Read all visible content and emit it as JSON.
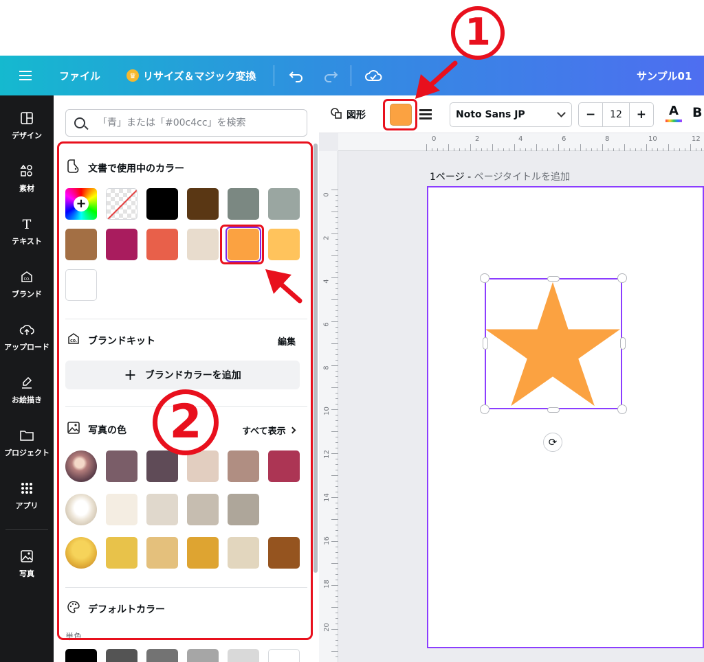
{
  "topbar": {
    "file_label": "ファイル",
    "resize_label": "リサイズ＆マジック変換",
    "doc_title": "サンプル01"
  },
  "rail": {
    "items": [
      {
        "label": "デザイン",
        "icon": "layout-icon"
      },
      {
        "label": "素材",
        "icon": "elements-icon"
      },
      {
        "label": "テキスト",
        "icon": "text-icon"
      },
      {
        "label": "ブランド",
        "icon": "brand-icon"
      },
      {
        "label": "アップロード",
        "icon": "upload-icon"
      },
      {
        "label": "お絵描き",
        "icon": "draw-icon"
      },
      {
        "label": "プロジェクト",
        "icon": "folder-icon"
      },
      {
        "label": "アプリ",
        "icon": "apps-icon"
      },
      {
        "label": "写真",
        "icon": "photo-icon"
      }
    ]
  },
  "panel": {
    "search_placeholder": "「青」または「#00c4cc」を検索",
    "doc_colors": {
      "title": "文書で使用中のカラー",
      "colors": [
        "#000000",
        "#5a3714",
        "#7b8882",
        "#9aa6a1",
        "#a36f44",
        "#a91c5e",
        "#e8604a",
        "#e8dccd",
        "#fba241",
        "#ffc35c",
        "#ffffff"
      ],
      "selected": "#fba241"
    },
    "brand_kit": {
      "title": "ブランドキット",
      "edit_label": "編集",
      "add_label": "ブランドカラーを追加"
    },
    "photo_colors": {
      "title": "写真の色",
      "show_all_label": "すべて表示",
      "rows": [
        [
          "#7a5d68",
          "#5f4b57",
          "#e2cec0",
          "#b08e82",
          "#ac3554"
        ],
        [
          "#f4ede2",
          "#e0d8cc",
          "#c6bdb0",
          "#aea69a"
        ],
        [
          "#e8c24a",
          "#e4c07c",
          "#dea431",
          "#e2d6be",
          "#95541f"
        ]
      ]
    },
    "default_colors": {
      "title": "デフォルトカラー",
      "subtitle": "単色",
      "colors": [
        "#000000",
        "#545454",
        "#737373",
        "#a6a6a6",
        "#d9d9d9",
        "#ffffff"
      ]
    }
  },
  "toolbar": {
    "shape_label": "図形",
    "fill_color": "#fba241",
    "font_name": "Noto Sans JP",
    "font_size": "12",
    "minus": "−",
    "plus": "+",
    "text_color_glyph": "A",
    "bold_glyph": "B"
  },
  "canvas": {
    "ruler_top": [
      "0",
      "2",
      "4",
      "6",
      "8",
      "10",
      "12"
    ],
    "ruler_left": [
      "0",
      "2",
      "4",
      "6",
      "8",
      "10",
      "12",
      "14",
      "16",
      "18",
      "20"
    ],
    "page_label": "1ページ - ",
    "page_title_placeholder": "ページタイトルを追加",
    "star_color": "#fba241"
  },
  "annotations": {
    "one": "1",
    "two": "2",
    "color": "#e8101d"
  }
}
